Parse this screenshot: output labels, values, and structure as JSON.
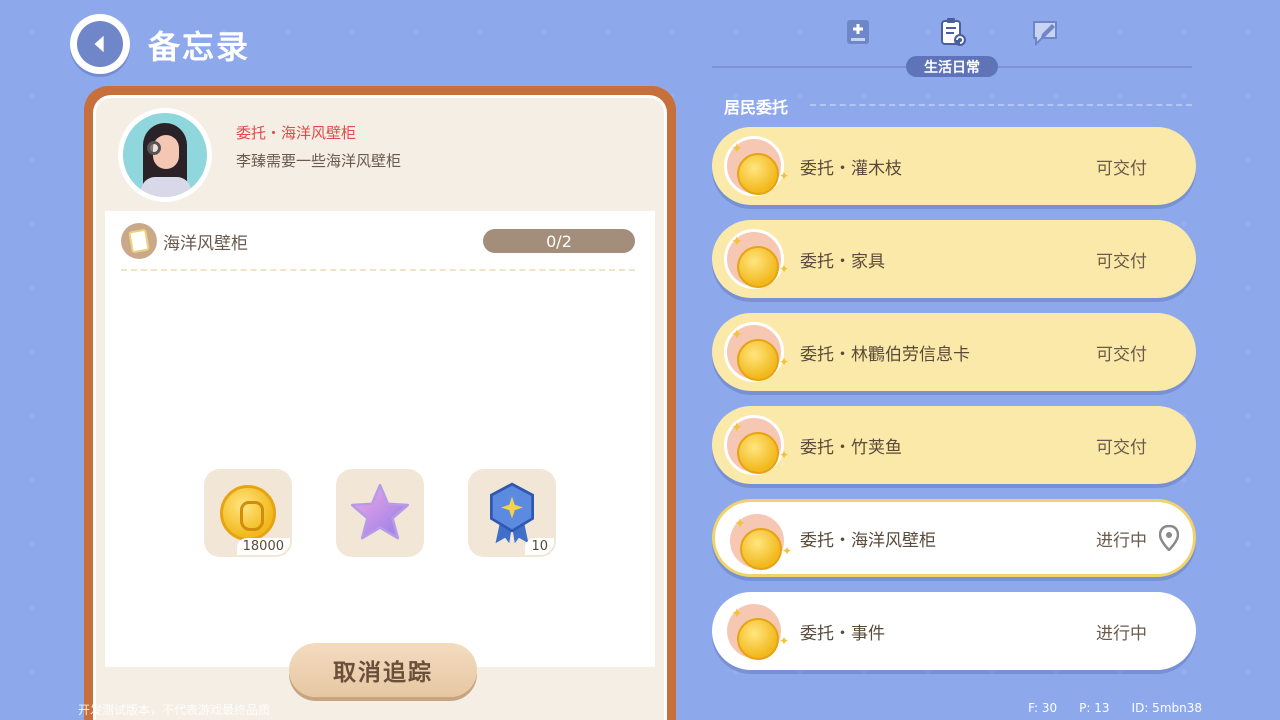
{
  "header": {
    "title": "备忘录"
  },
  "tabs": [
    {
      "icon": "book-plus-icon"
    },
    {
      "icon": "clipboard-refresh-icon",
      "label": "生活日常",
      "active": true
    },
    {
      "icon": "speech-pen-icon"
    }
  ],
  "section": {
    "label": "居民委托"
  },
  "detail": {
    "title": "委托・海洋风壁柜",
    "description": "李臻需要一些海洋风壁柜",
    "requirement": {
      "label": "海洋风壁柜",
      "progress": "0/2"
    },
    "rewards": [
      {
        "icon": "acorn-coin-icon",
        "count": "18000"
      },
      {
        "icon": "purple-star-icon",
        "count": ""
      },
      {
        "icon": "blue-badge-icon",
        "count": "10"
      }
    ],
    "cancel_label": "取消追踪"
  },
  "quests": [
    {
      "name": "委托・灌木枝",
      "status": "可交付"
    },
    {
      "name": "委托・家具",
      "status": "可交付"
    },
    {
      "name": "委托・林鸜伯劳信息卡",
      "status": "可交付"
    },
    {
      "name": "委托・竹荚鱼",
      "status": "可交付"
    },
    {
      "name": "委托・海洋风壁柜",
      "status": "进行中"
    },
    {
      "name": "委托・事件",
      "status": "进行中"
    }
  ],
  "footer": {
    "note": "开发测试版本，不代表游戏最终品质",
    "f": "F: 30",
    "p": "P: 13",
    "id": "ID: 5mbn38"
  },
  "colors": {
    "background": "#8ea8ec",
    "panel_border": "#c8703b",
    "quest_deliverable": "#fbe9a9",
    "quest_title_red": "#e04a4a"
  }
}
